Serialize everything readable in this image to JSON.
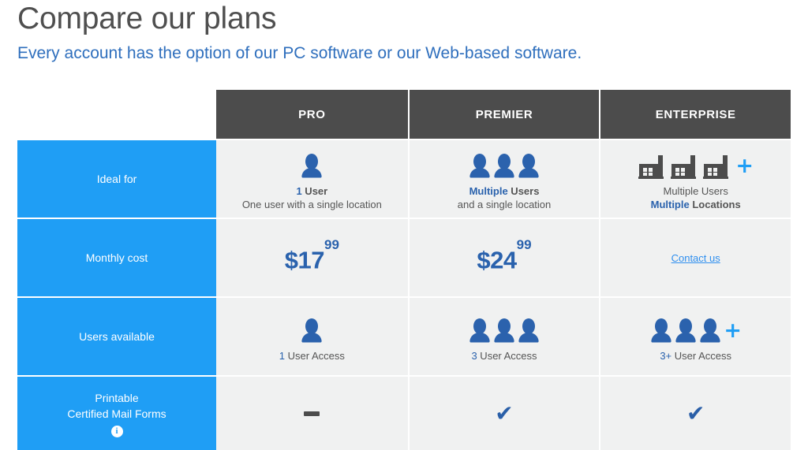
{
  "header": {
    "title": "Compare our plans",
    "subtitle": "Every account has the option of our PC software or our Web-based software."
  },
  "colors": {
    "accent_blue": "#1f9ef5",
    "dark_blue": "#2a62ad",
    "header_gray": "#4c4c4c",
    "cell_gray": "#f0f1f1",
    "title_gray": "#4f4f4f",
    "subtitle_blue": "#2f6fbd",
    "link_blue": "#2f8fef"
  },
  "table": {
    "corner_label": "",
    "plans": [
      {
        "name": "PRO"
      },
      {
        "name": "PREMIER"
      },
      {
        "name": "ENTERPRISE"
      }
    ],
    "rows": [
      {
        "label_lines": [
          "Ideal for"
        ],
        "has_info_icon": false,
        "cells": [
          {
            "icon": "person-icon",
            "icon_count": 1,
            "plus": false,
            "caption_1_blue": "1",
            "caption_1_gray": " User",
            "caption_2_blue": "",
            "caption_2_gray": "One user with a single location"
          },
          {
            "icon": "person-icon",
            "icon_count": 3,
            "plus": false,
            "caption_1_blue": "Multiple",
            "caption_1_gray": " Users",
            "caption_2_blue": "",
            "caption_2_gray": "and a single location"
          },
          {
            "icon": "building-icon",
            "icon_count": 3,
            "plus": true,
            "caption_1_blue": "",
            "caption_1_gray": "Multiple Users",
            "caption_2_blue": "Multiple",
            "caption_2_gray": " Locations"
          }
        ]
      },
      {
        "label_lines": [
          "Monthly cost"
        ],
        "has_info_icon": false,
        "cells": [
          {
            "type": "price",
            "currency": "$",
            "amount": "17",
            "cents": "99"
          },
          {
            "type": "price",
            "currency": "$",
            "amount": "24",
            "cents": "99"
          },
          {
            "type": "link",
            "link_text": "Contact us"
          }
        ]
      },
      {
        "label_lines": [
          "Users available"
        ],
        "has_info_icon": false,
        "cells": [
          {
            "icon": "person-icon",
            "icon_count": 1,
            "plus": false,
            "caption_1_blue": "1",
            "caption_1_gray": " User Access",
            "caption_2_blue": "",
            "caption_2_gray": ""
          },
          {
            "icon": "person-icon",
            "icon_count": 3,
            "plus": false,
            "caption_1_blue": "3",
            "caption_1_gray": " User Access",
            "caption_2_blue": "",
            "caption_2_gray": ""
          },
          {
            "icon": "person-icon",
            "icon_count": 3,
            "plus": true,
            "caption_1_blue": "3+",
            "caption_1_gray": " User Access",
            "caption_2_blue": "",
            "caption_2_gray": ""
          }
        ]
      },
      {
        "label_lines": [
          "Printable",
          "Certified Mail Forms"
        ],
        "has_info_icon": true,
        "info_icon_glyph": "i",
        "cells": [
          {
            "type": "mark",
            "mark": "dash"
          },
          {
            "type": "mark",
            "mark": "check",
            "glyph": "✔"
          },
          {
            "type": "mark",
            "mark": "check",
            "glyph": "✔"
          }
        ]
      }
    ]
  }
}
